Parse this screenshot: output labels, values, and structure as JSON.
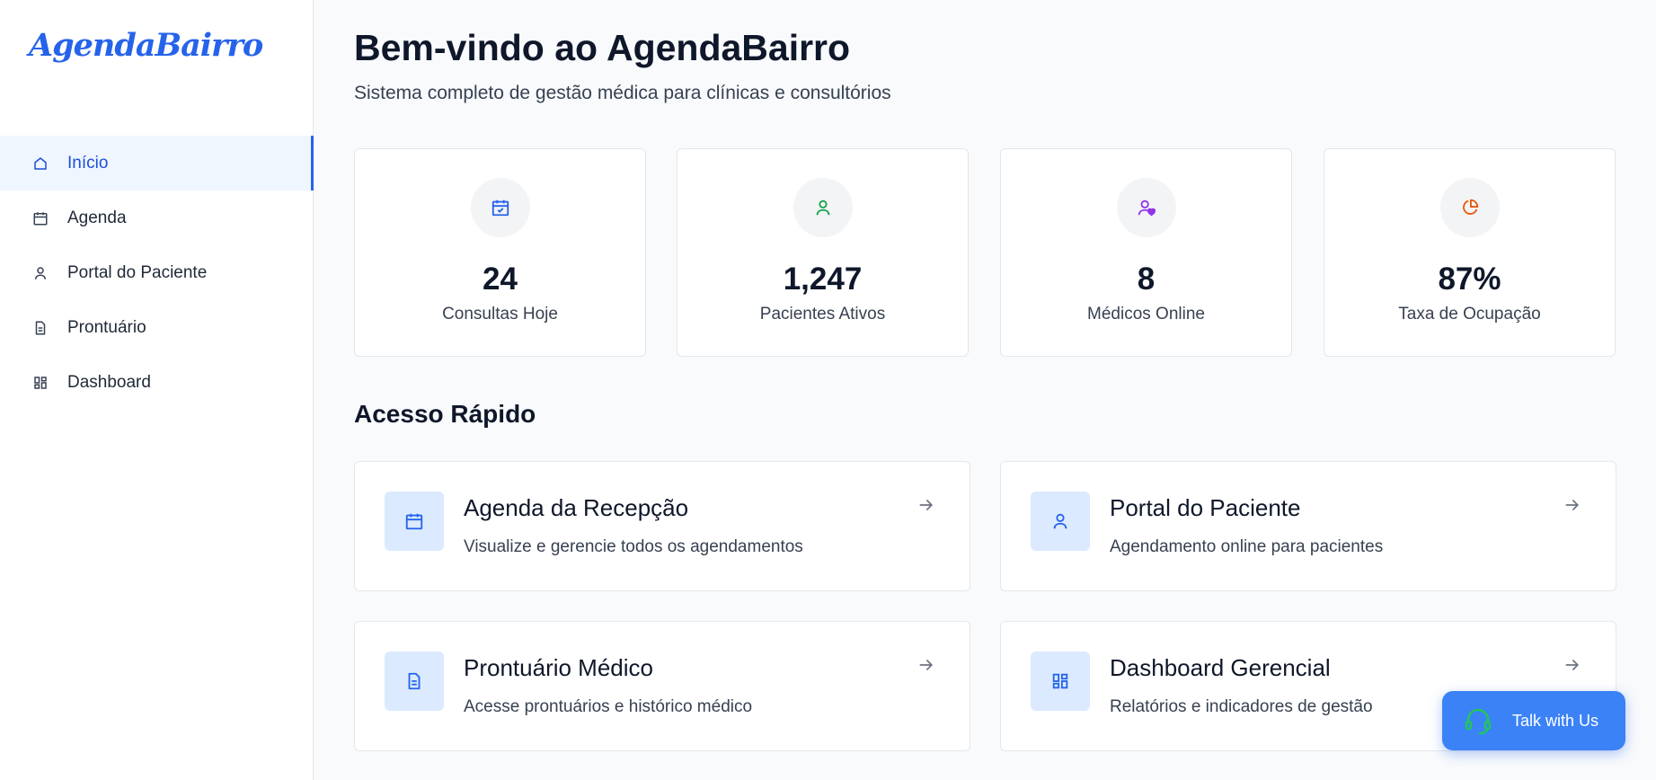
{
  "app": {
    "logo": "AgendaBairro"
  },
  "sidebar": {
    "items": [
      {
        "label": "Início",
        "icon": "home-icon",
        "active": true
      },
      {
        "label": "Agenda",
        "icon": "calendar-icon"
      },
      {
        "label": "Portal do Paciente",
        "icon": "user-icon"
      },
      {
        "label": "Prontuário",
        "icon": "document-icon"
      },
      {
        "label": "Dashboard",
        "icon": "dashboard-icon"
      }
    ]
  },
  "header": {
    "title": "Bem-vindo ao AgendaBairro",
    "subtitle": "Sistema completo de gestão médica para clínicas e consultórios"
  },
  "stats": [
    {
      "value": "24",
      "label": "Consultas Hoje",
      "icon": "calendar-check-icon",
      "color": "#2563eb"
    },
    {
      "value": "1,247",
      "label": "Pacientes Ativos",
      "icon": "user-icon",
      "color": "#16a34a"
    },
    {
      "value": "8",
      "label": "Médicos Online",
      "icon": "user-heart-icon",
      "color": "#9333ea"
    },
    {
      "value": "87%",
      "label": "Taxa de Ocupação",
      "icon": "pie-chart-icon",
      "color": "#ea580c"
    }
  ],
  "quick_access": {
    "title": "Acesso Rápido",
    "cards": [
      {
        "title": "Agenda da Recepção",
        "description": "Visualize e gerencie todos os agendamentos",
        "icon": "calendar-icon"
      },
      {
        "title": "Portal do Paciente",
        "description": "Agendamento online para pacientes",
        "icon": "user-icon"
      },
      {
        "title": "Prontuário Médico",
        "description": "Acesse prontuários e histórico médico",
        "icon": "document-icon"
      },
      {
        "title": "Dashboard Gerencial",
        "description": "Relatórios e indicadores de gestão",
        "icon": "dashboard-icon"
      }
    ]
  },
  "chat": {
    "label": "Talk with Us",
    "icon": "headset-icon"
  },
  "colors": {
    "accent": "#2563eb",
    "chat_button": "#3b82f6",
    "icon_bg": "#dbeafe"
  }
}
